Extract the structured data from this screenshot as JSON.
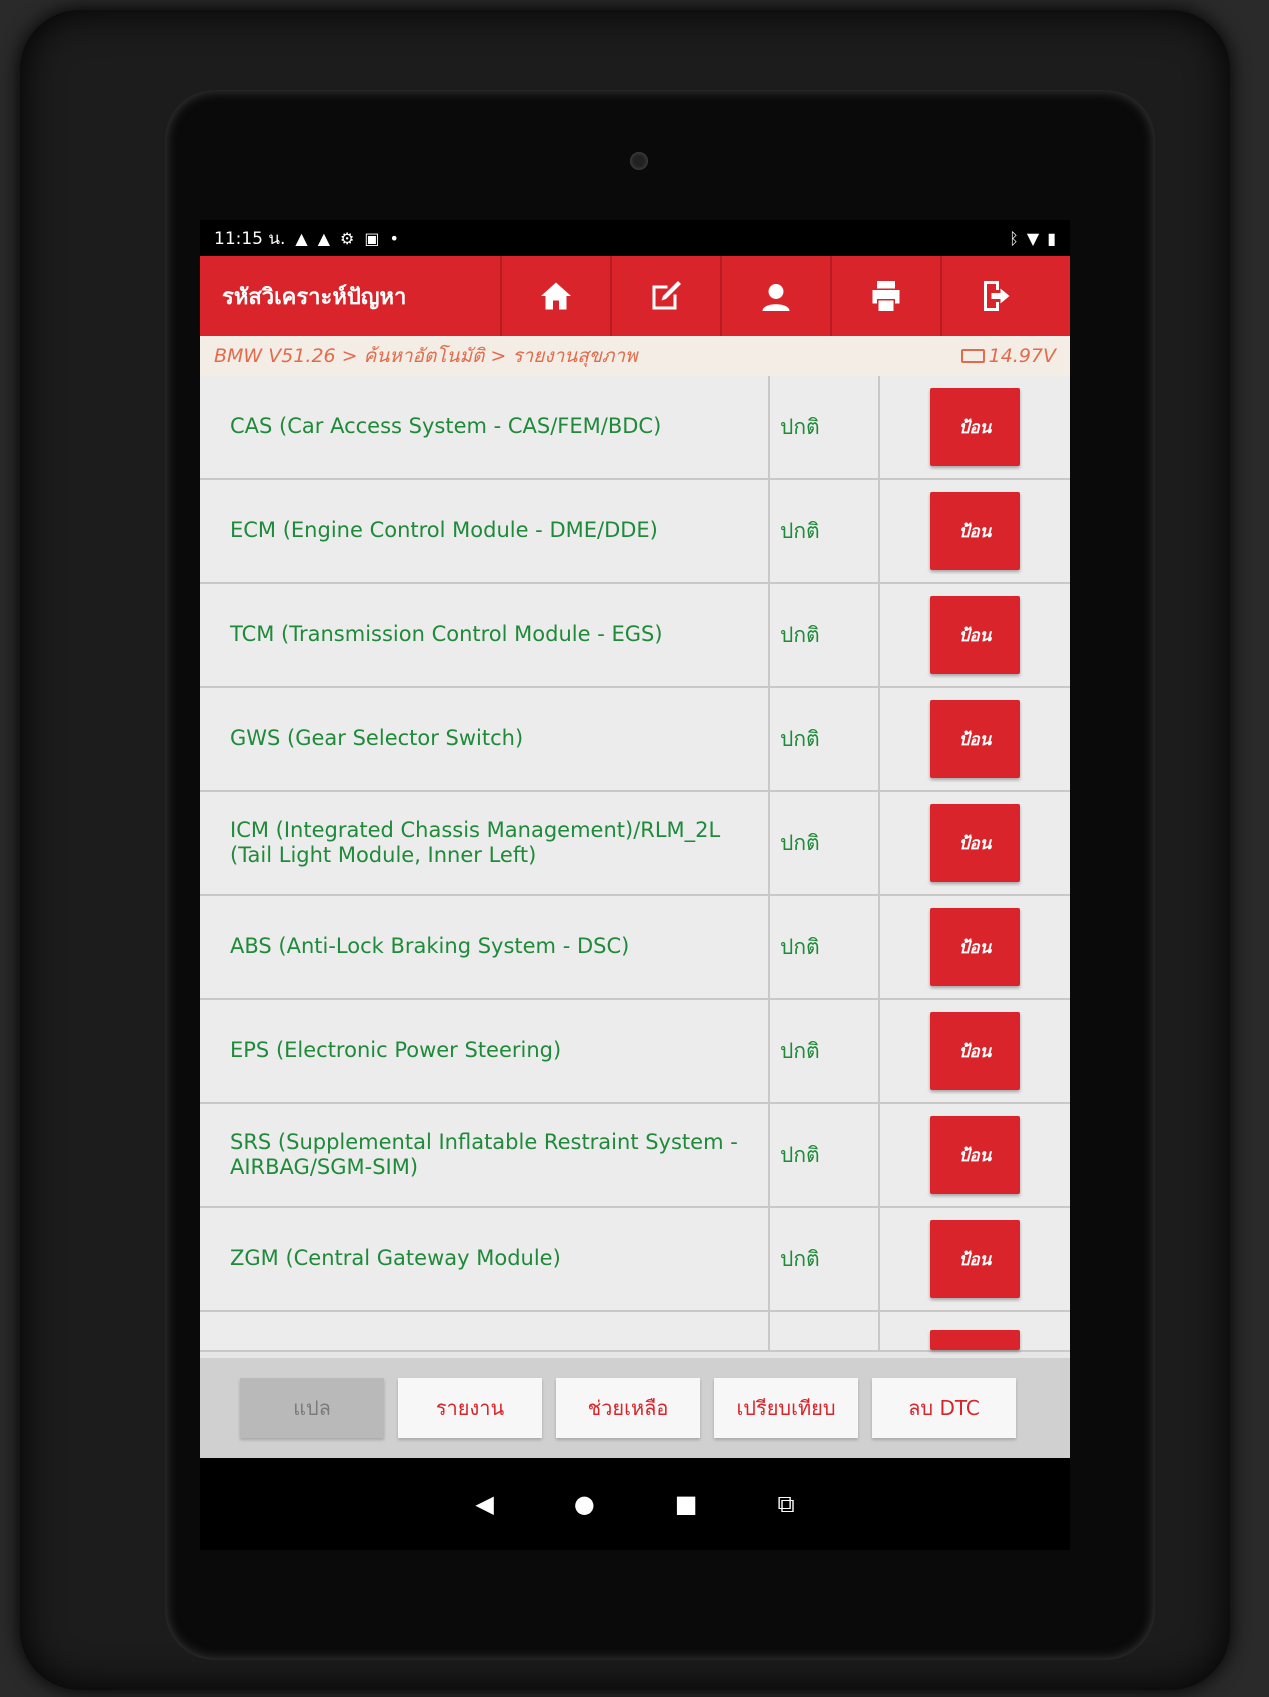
{
  "status_bar": {
    "time": "11:15 น.",
    "left_icons": [
      "warning-icon",
      "warning-icon",
      "settings-icon",
      "image-icon",
      "dot-icon"
    ],
    "right_icons": [
      "bluetooth-icon",
      "wifi-icon",
      "battery-icon"
    ]
  },
  "header": {
    "title": "รหัสวิเคราะห์ปัญหา",
    "buttons": [
      "home-icon",
      "edit-icon",
      "user-icon",
      "printer-icon",
      "exit-icon"
    ]
  },
  "breadcrumb": {
    "path": "BMW V51.26 > ค้นหาอัตโนมัติ > รายงานสุขภาพ",
    "voltage": "14.97V"
  },
  "modules": [
    {
      "name": "CAS (Car Access System - CAS/FEM/BDC)",
      "status": "ปกติ",
      "action": "ป้อน"
    },
    {
      "name": "ECM (Engine Control Module - DME/DDE)",
      "status": "ปกติ",
      "action": "ป้อน"
    },
    {
      "name": "TCM (Transmission Control Module - EGS)",
      "status": "ปกติ",
      "action": "ป้อน"
    },
    {
      "name": "GWS (Gear Selector Switch)",
      "status": "ปกติ",
      "action": "ป้อน"
    },
    {
      "name": "ICM (Integrated Chassis Management)/RLM_2L (Tail Light Module, Inner Left)",
      "status": "ปกติ",
      "action": "ป้อน"
    },
    {
      "name": "ABS (Anti-Lock Braking System - DSC)",
      "status": "ปกติ",
      "action": "ป้อน"
    },
    {
      "name": "EPS (Electronic Power Steering)",
      "status": "ปกติ",
      "action": "ป้อน"
    },
    {
      "name": "SRS (Supplemental Inflatable Restraint System - AIRBAG/SGM-SIM)",
      "status": "ปกติ",
      "action": "ป้อน"
    },
    {
      "name": "ZGM (Central Gateway Module)",
      "status": "ปกติ",
      "action": "ป้อน"
    }
  ],
  "bottom_buttons": [
    {
      "label": "แปล",
      "disabled": true
    },
    {
      "label": "รายงาน",
      "disabled": false
    },
    {
      "label": "ช่วยเหลือ",
      "disabled": false
    },
    {
      "label": "เปรียบเทียบ",
      "disabled": false
    },
    {
      "label": "ลบ DTC",
      "disabled": false
    }
  ],
  "nav_bar": [
    "back-icon",
    "home-icon",
    "recents-icon",
    "screenshot-icon"
  ],
  "colors": {
    "accent": "#d8242a",
    "module_text": "#1f8a39",
    "breadcrumb_text": "#e26b4b"
  }
}
